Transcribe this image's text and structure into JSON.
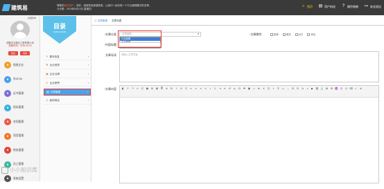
{
  "header": {
    "logo_text": "建筑易",
    "welcome_line1_a": "尊敬的",
    "welcome_line1_hl": "会员用户",
    "welcome_line1_b": "，您好，感谢您选择建筑易，让我们一起实现一个行业管理模式的变革。",
    "welcome_line2": "今天是：2019年6月13日 星期四",
    "nav": [
      {
        "icon": "home-icon",
        "glyph": "⌂",
        "label": "首页",
        "active": true
      },
      {
        "icon": "document-icon",
        "glyph": "▤",
        "label": "用户协议",
        "active": false
      },
      {
        "icon": "help-icon",
        "glyph": "?",
        "label": "操作指南",
        "active": false
      },
      {
        "icon": "logout-icon",
        "glyph": "↦",
        "label": "安全退出",
        "active": false
      }
    ]
  },
  "sidebar": {
    "label": "隐藏菜单",
    "company": "成都中天建业工程有限公司",
    "vip": "到期时间：2039-06-24",
    "btn_a": "退出",
    "btn_b": "切换",
    "items": [
      {
        "icon": "hire-icon",
        "label": "找易企业",
        "color": "#f0a02a"
      },
      {
        "icon": "office-icon",
        "label": "办公OA",
        "color": "#4a9ee8"
      },
      {
        "icon": "doc-icon",
        "label": "证书管理",
        "color": "#7b6fd6"
      },
      {
        "icon": "bid-icon",
        "label": "投标管理",
        "color": "#3cb0e0"
      },
      {
        "icon": "contract-icon",
        "label": "合同管理",
        "color": "#e85c4a"
      },
      {
        "icon": "project-icon",
        "label": "项目管理",
        "color": "#f07a2a"
      },
      {
        "icon": "finance-icon",
        "label": "财务管理",
        "color": "#e0453a"
      },
      {
        "icon": "staff-icon",
        "label": "员工管理",
        "color": "#3ab8a0"
      },
      {
        "icon": "system-icon",
        "label": "系统设置",
        "color": "#555555"
      }
    ]
  },
  "menu2": {
    "banner_title": "目录",
    "banner_sub": "CATALOGUE",
    "items": [
      {
        "icon": "leaf-icon",
        "glyph": "✎",
        "label": "基本信息",
        "active": false
      },
      {
        "icon": "bank-icon",
        "glyph": "♜",
        "label": "企业资质",
        "active": false
      },
      {
        "icon": "honor-icon",
        "glyph": "▣",
        "label": "企业业绩",
        "active": false
      },
      {
        "icon": "award-icon",
        "glyph": "♔",
        "label": "企业荣誉",
        "active": false
      },
      {
        "icon": "article-icon",
        "glyph": "▤",
        "label": "文章管理",
        "active": true
      },
      {
        "icon": "website-icon",
        "glyph": "◎",
        "label": "我的网站",
        "active": false
      }
    ]
  },
  "content": {
    "crumb_a": "◎ 文章管理",
    "crumb_b": "文章列表",
    "category_label": "文章分类",
    "category_placeholder": "-分类选择-",
    "category_options": [
      "行业新闻",
      "企业新闻",
      "技术方案"
    ],
    "props_label": "文章属性",
    "props": [
      "推荐",
      "置顶",
      "幻灯",
      "滚动"
    ],
    "title_label": "内容标题",
    "summary_label": "文章导读",
    "summary_placeholder": "请输入文章导读",
    "body_label": "文章内容"
  },
  "toolbar_glyphs": [
    "◧",
    "↶",
    "↷",
    "✂",
    "⎘",
    "▦",
    "⊞",
    "▤",
    "≣",
    "A",
    "B",
    "I",
    "U",
    "S",
    "≡",
    "≡",
    "≡",
    "≡",
    "•",
    "1.",
    "⇥",
    "⇤",
    "x²",
    "x₂",
    "Ω",
    "⚑",
    "▣",
    "☺",
    "⊕",
    "✕",
    "◫",
    "⌗",
    "¶",
    "▭",
    "↔",
    "⊟",
    "⊡",
    "⇲",
    "♫",
    "▶",
    "⛓",
    "⚓",
    "⊠",
    "⊞",
    "♒",
    "⊡",
    "⎙",
    "⌫",
    "✓",
    "⊘"
  ],
  "watermark": "小小知识库"
}
